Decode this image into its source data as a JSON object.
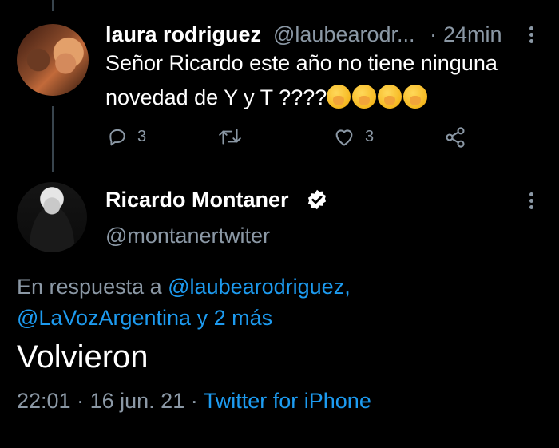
{
  "reply_tweet": {
    "name": "laura rodriguez",
    "handle": "@laubearodr...",
    "separator": "·",
    "time": "24min",
    "text": "Señor Ricardo este año no tiene ninguna novedad de Y y T ????",
    "emoji_count": 4,
    "emoji_name": "face-with-hand-over-mouth",
    "replies": "3",
    "likes": "3"
  },
  "main_tweet": {
    "name": "Ricardo Montaner",
    "verified": true,
    "handle": "@montanertwiter",
    "reply_prefix": "En respuesta a",
    "reply_mention_1": "@laubearodriguez,",
    "reply_mention_2": "@LaVozArgentina",
    "reply_and": "y",
    "reply_more": "2 más",
    "text": "Volvieron",
    "time": "22:01",
    "dot": "·",
    "date": "16 jun. 21",
    "source": "Twitter for iPhone"
  },
  "colors": {
    "background": "#000000",
    "text": "#ffffff",
    "muted": "#8b98a5",
    "link": "#1d9bf0",
    "thread_line": "#38444d"
  }
}
